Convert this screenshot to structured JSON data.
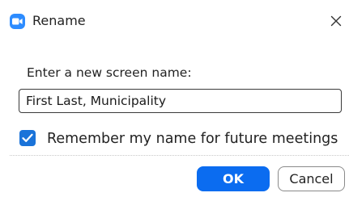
{
  "dialog": {
    "title": "Rename",
    "app_icon": "video-camera-icon",
    "close_icon": "close-icon"
  },
  "form": {
    "prompt_label": "Enter a new screen name:",
    "name_value": "First Last, Municipality",
    "remember_label": "Remember my name for future meetings",
    "remember_checked": true
  },
  "buttons": {
    "ok_label": "OK",
    "cancel_label": "Cancel"
  },
  "colors": {
    "accent": "#0b6cf0",
    "app_icon": "#2d8cff",
    "checkbox": "#1a73d9"
  }
}
